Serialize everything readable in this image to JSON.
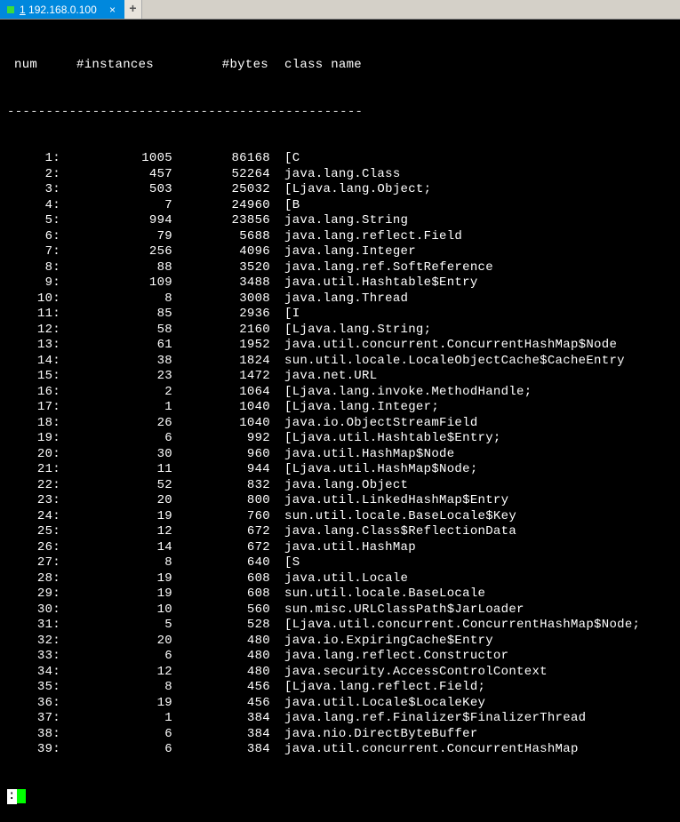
{
  "tab": {
    "title_prefix": "1",
    "title_rest": " 192.168.0.100",
    "close": "×",
    "add": "+"
  },
  "headers": {
    "num": "num",
    "instances": "#instances",
    "bytes": "#bytes",
    "class": "class name"
  },
  "divider": "----------------------------------------------",
  "rows": [
    {
      "num": "1:",
      "instances": "1005",
      "bytes": "86168",
      "class": "[C"
    },
    {
      "num": "2:",
      "instances": "457",
      "bytes": "52264",
      "class": "java.lang.Class"
    },
    {
      "num": "3:",
      "instances": "503",
      "bytes": "25032",
      "class": "[Ljava.lang.Object;"
    },
    {
      "num": "4:",
      "instances": "7",
      "bytes": "24960",
      "class": "[B"
    },
    {
      "num": "5:",
      "instances": "994",
      "bytes": "23856",
      "class": "java.lang.String"
    },
    {
      "num": "6:",
      "instances": "79",
      "bytes": "5688",
      "class": "java.lang.reflect.Field"
    },
    {
      "num": "7:",
      "instances": "256",
      "bytes": "4096",
      "class": "java.lang.Integer"
    },
    {
      "num": "8:",
      "instances": "88",
      "bytes": "3520",
      "class": "java.lang.ref.SoftReference"
    },
    {
      "num": "9:",
      "instances": "109",
      "bytes": "3488",
      "class": "java.util.Hashtable$Entry"
    },
    {
      "num": "10:",
      "instances": "8",
      "bytes": "3008",
      "class": "java.lang.Thread"
    },
    {
      "num": "11:",
      "instances": "85",
      "bytes": "2936",
      "class": "[I"
    },
    {
      "num": "12:",
      "instances": "58",
      "bytes": "2160",
      "class": "[Ljava.lang.String;"
    },
    {
      "num": "13:",
      "instances": "61",
      "bytes": "1952",
      "class": "java.util.concurrent.ConcurrentHashMap$Node"
    },
    {
      "num": "14:",
      "instances": "38",
      "bytes": "1824",
      "class": "sun.util.locale.LocaleObjectCache$CacheEntry"
    },
    {
      "num": "15:",
      "instances": "23",
      "bytes": "1472",
      "class": "java.net.URL"
    },
    {
      "num": "16:",
      "instances": "2",
      "bytes": "1064",
      "class": "[Ljava.lang.invoke.MethodHandle;"
    },
    {
      "num": "17:",
      "instances": "1",
      "bytes": "1040",
      "class": "[Ljava.lang.Integer;"
    },
    {
      "num": "18:",
      "instances": "26",
      "bytes": "1040",
      "class": "java.io.ObjectStreamField"
    },
    {
      "num": "19:",
      "instances": "6",
      "bytes": "992",
      "class": "[Ljava.util.Hashtable$Entry;"
    },
    {
      "num": "20:",
      "instances": "30",
      "bytes": "960",
      "class": "java.util.HashMap$Node"
    },
    {
      "num": "21:",
      "instances": "11",
      "bytes": "944",
      "class": "[Ljava.util.HashMap$Node;"
    },
    {
      "num": "22:",
      "instances": "52",
      "bytes": "832",
      "class": "java.lang.Object"
    },
    {
      "num": "23:",
      "instances": "20",
      "bytes": "800",
      "class": "java.util.LinkedHashMap$Entry"
    },
    {
      "num": "24:",
      "instances": "19",
      "bytes": "760",
      "class": "sun.util.locale.BaseLocale$Key"
    },
    {
      "num": "25:",
      "instances": "12",
      "bytes": "672",
      "class": "java.lang.Class$ReflectionData"
    },
    {
      "num": "26:",
      "instances": "14",
      "bytes": "672",
      "class": "java.util.HashMap"
    },
    {
      "num": "27:",
      "instances": "8",
      "bytes": "640",
      "class": "[S"
    },
    {
      "num": "28:",
      "instances": "19",
      "bytes": "608",
      "class": "java.util.Locale"
    },
    {
      "num": "29:",
      "instances": "19",
      "bytes": "608",
      "class": "sun.util.locale.BaseLocale"
    },
    {
      "num": "30:",
      "instances": "10",
      "bytes": "560",
      "class": "sun.misc.URLClassPath$JarLoader"
    },
    {
      "num": "31:",
      "instances": "5",
      "bytes": "528",
      "class": "[Ljava.util.concurrent.ConcurrentHashMap$Node;"
    },
    {
      "num": "32:",
      "instances": "20",
      "bytes": "480",
      "class": "java.io.ExpiringCache$Entry"
    },
    {
      "num": "33:",
      "instances": "6",
      "bytes": "480",
      "class": "java.lang.reflect.Constructor"
    },
    {
      "num": "34:",
      "instances": "12",
      "bytes": "480",
      "class": "java.security.AccessControlContext"
    },
    {
      "num": "35:",
      "instances": "8",
      "bytes": "456",
      "class": "[Ljava.lang.reflect.Field;"
    },
    {
      "num": "36:",
      "instances": "19",
      "bytes": "456",
      "class": "java.util.Locale$LocaleKey"
    },
    {
      "num": "37:",
      "instances": "1",
      "bytes": "384",
      "class": "java.lang.ref.Finalizer$FinalizerThread"
    },
    {
      "num": "38:",
      "instances": "6",
      "bytes": "384",
      "class": "java.nio.DirectByteBuffer"
    },
    {
      "num": "39:",
      "instances": "6",
      "bytes": "384",
      "class": "java.util.concurrent.ConcurrentHashMap"
    }
  ],
  "prompt": ":"
}
